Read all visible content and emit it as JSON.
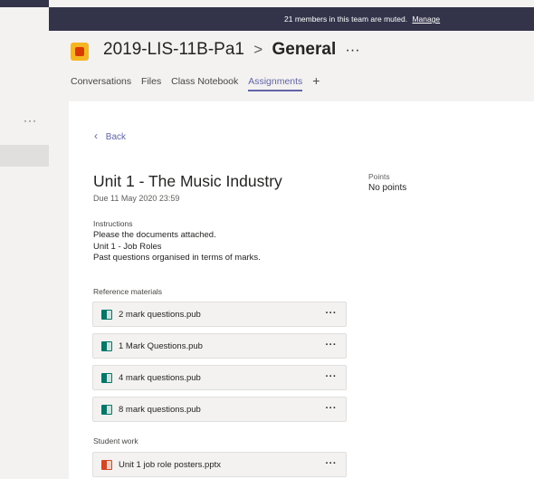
{
  "rail": {
    "more_label": "···"
  },
  "banner": {
    "text": "21 members in this team are muted.",
    "link": "Manage"
  },
  "header": {
    "team_name": "2019-LIS-11B-Pa1",
    "separator": ">",
    "channel_name": "General",
    "more": "···",
    "tabs": [
      {
        "label": "Conversations",
        "active": false
      },
      {
        "label": "Files",
        "active": false
      },
      {
        "label": "Class Notebook",
        "active": false
      },
      {
        "label": "Assignments",
        "active": true
      }
    ],
    "add_tab": "+"
  },
  "assignment": {
    "back_label": "Back",
    "title": "Unit 1 - The Music Industry",
    "due": "Due 11 May 2020 23:59",
    "points_label": "Points",
    "points_value": "No points",
    "instructions_label": "Instructions",
    "instructions": [
      "Please the documents attached.",
      "Unit 1 - Job Roles",
      "Past questions organised in terms of marks."
    ],
    "reference_label": "Reference materials",
    "reference_files": [
      {
        "name": "2 mark questions.pub",
        "icon": "publisher-file-icon",
        "more": "···"
      },
      {
        "name": "1 Mark Questions.pub",
        "icon": "publisher-file-icon",
        "more": "···"
      },
      {
        "name": "4 mark questions.pub",
        "icon": "publisher-file-icon",
        "more": "···"
      },
      {
        "name": "8 mark questions.pub",
        "icon": "publisher-file-icon",
        "more": "···"
      }
    ],
    "student_work_label": "Student work",
    "student_files": [
      {
        "name": "Unit 1 job role posters.pptx",
        "icon": "powerpoint-file-icon",
        "more": "···"
      }
    ]
  },
  "colors": {
    "accent": "#6264a7",
    "banner_bg": "#33344a",
    "publisher": "#077568",
    "powerpoint": "#d24726",
    "team_logo": "#f6b523"
  }
}
